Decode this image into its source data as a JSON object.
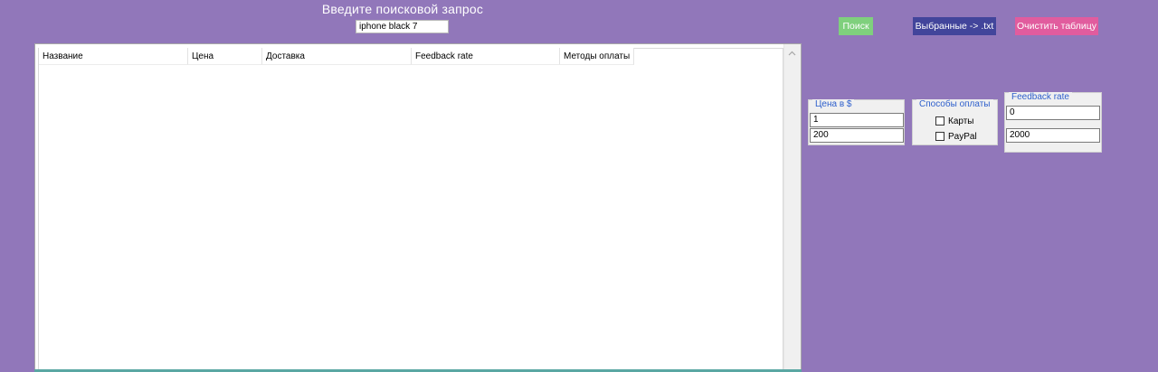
{
  "search": {
    "label": "Введите поисковой запрос",
    "value": "iphone black 7"
  },
  "buttons": {
    "search": "Поиск",
    "export": "Выбранные -> .txt",
    "clear": "Очистить таблицу"
  },
  "colors": {
    "background": "#9177ba",
    "search_button": "#7fd07d",
    "export_button": "#42459b",
    "clear_button": "#e15c9e",
    "group_title": "#2d5fcc"
  },
  "table": {
    "columns": [
      "Название",
      "Цена",
      "Доставка",
      "Feedback rate",
      "Методы оплаты"
    ],
    "rows": []
  },
  "filters": {
    "price": {
      "title": "Цена в $",
      "min": "1",
      "max": "200"
    },
    "payment": {
      "title": "Способы оплаты",
      "options": [
        {
          "label": "Карты",
          "checked": false
        },
        {
          "label": "PayPal",
          "checked": false
        }
      ]
    },
    "feedback": {
      "title": "Feedback rate",
      "min": "0",
      "max": "2000"
    }
  },
  "icons": {
    "scroll_up": "chevron-up-icon"
  }
}
